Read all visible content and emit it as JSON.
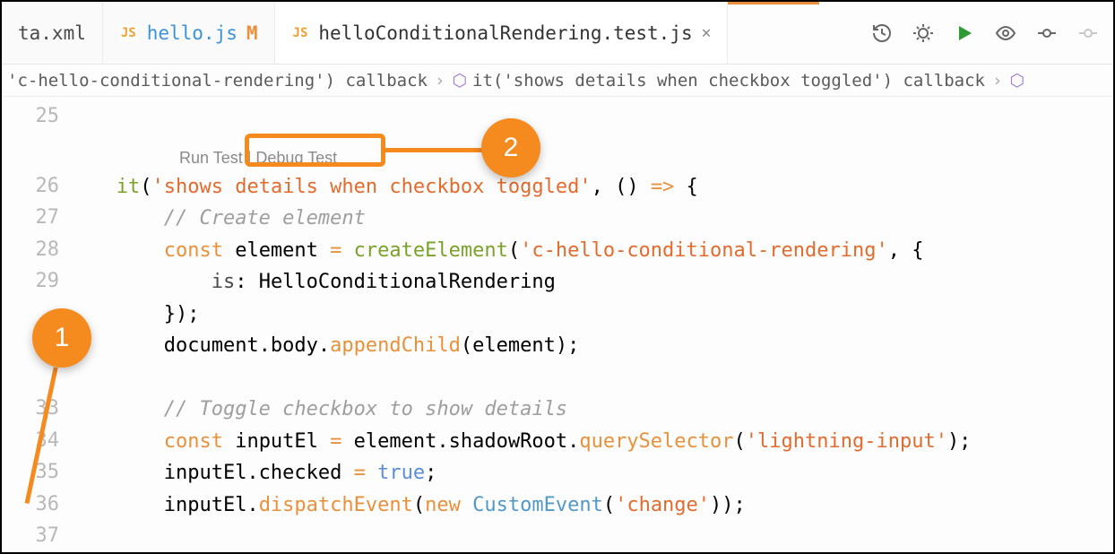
{
  "tabs": {
    "t0": {
      "icon": "",
      "name": "ta.xml",
      "modified": ""
    },
    "t1": {
      "icon": "JS",
      "name": "hello.js",
      "modified": "M"
    },
    "t2": {
      "icon": "JS",
      "name": "helloConditionalRendering.test.js",
      "modified": ""
    }
  },
  "toolbar": {
    "history": "history",
    "debug": "debug",
    "run": "run",
    "watch": "watch",
    "commit": "commit",
    "more": "more"
  },
  "breadcrumbs": {
    "b0": "'c-hello-conditional-rendering') callback",
    "b1": "it('shows details when checkbox toggled') callback"
  },
  "gutter": {
    "l25": "25",
    "l26": "26",
    "l27": "27",
    "l28": "28",
    "l29": "29",
    "l30": " ",
    "l31": " ",
    "l32": " ",
    "l33": "33",
    "l34": "34",
    "l35": "35",
    "l36": "36",
    "l37": "37"
  },
  "codelens": {
    "run": "Run Test",
    "sep": " | ",
    "debug": "Debug Test"
  },
  "code": {
    "l26a": "it",
    "l26b": "(",
    "l26c": "'shows details when checkbox toggled'",
    "l26d": ", () ",
    "l26e": "=>",
    "l26f": " {",
    "l27a": "// Create element",
    "l28a": "const",
    "l28b": " element ",
    "l28op": "=",
    "l28c": " createElement",
    "l28d": "(",
    "l28e": "'c-hello-conditional-rendering'",
    "l28f": ", {",
    "l29a": "is",
    "l29b": ": HelloConditionalRendering",
    "l30a": "});",
    "l31a": "document.body.",
    "l31b": "appendChild",
    "l31c": "(element);",
    "l33a": "// Toggle checkbox to show details",
    "l34a": "const",
    "l34b": " inputEl ",
    "l34op": "=",
    "l34c": " element.shadowRoot.",
    "l34d": "querySelector",
    "l34e": "(",
    "l34f": "'lightning-input'",
    "l34g": ");",
    "l35a": "inputEl.checked ",
    "l35op": "=",
    "l35b": " ",
    "l35c": "true",
    "l35d": ";",
    "l36a": "inputEl.",
    "l36b": "dispatchEvent",
    "l36c": "(",
    "l36d": "new",
    "l36e": " ",
    "l36f": "CustomEvent",
    "l36g": "(",
    "l36h": "'change'",
    "l36i": "));"
  },
  "callouts": {
    "one": "1",
    "two": "2"
  }
}
